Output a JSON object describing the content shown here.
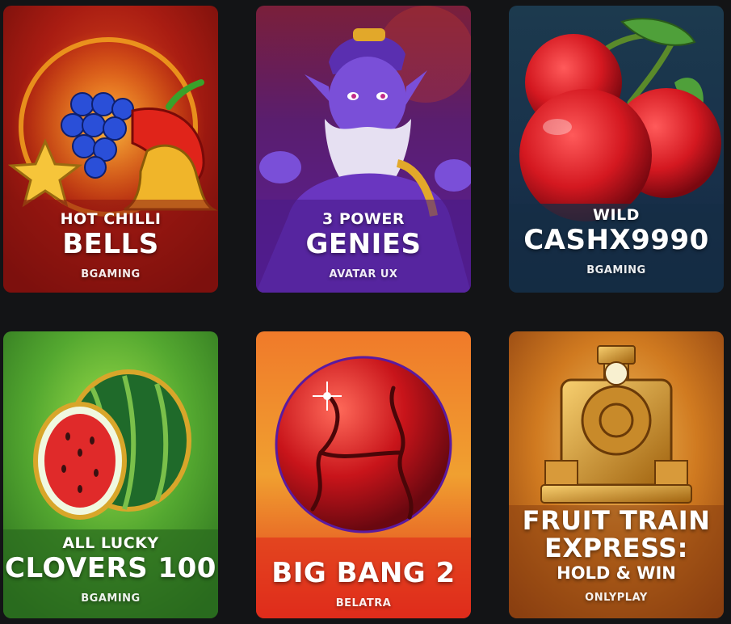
{
  "games": [
    {
      "line1": "HOT CHILLI",
      "line2": "BELLS",
      "provider": "BGAMING"
    },
    {
      "line1": "3 POWER",
      "line2": "GENIES",
      "provider": "AVATAR UX"
    },
    {
      "line1": "WILD",
      "line2": "CASHX9990",
      "provider": "BGAMING"
    },
    {
      "line1": "ALL LUCKY",
      "line2": "CLOVERS 100",
      "provider": "BGAMING"
    },
    {
      "line1": "BIG BANG 2",
      "provider": "BELATRA"
    },
    {
      "line1": "FRUIT TRAIN",
      "line2": "EXPRESS:",
      "line3": "HOLD & WIN",
      "provider": "ONLYPLAY"
    }
  ]
}
